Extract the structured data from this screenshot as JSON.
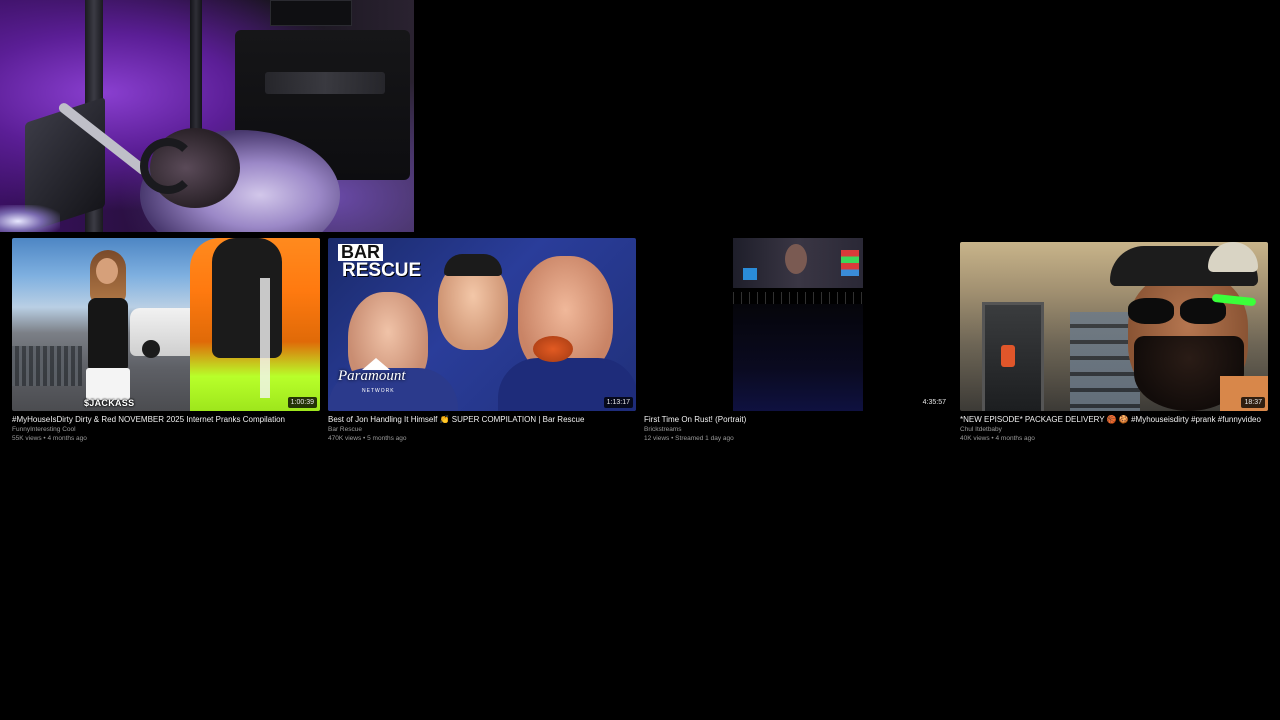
{
  "webcam": {
    "label": "Streamer webcam overlay"
  },
  "videos": [
    {
      "title": "#MyHouseIsDirty Dirty & Red NOVEMBER 2025 Internet Pranks Compilation",
      "channel": "FunnyInteresting Cool",
      "stats": "55K views • 4 months ago",
      "duration": "1:00:39",
      "thumb_text": "$JACKASS"
    },
    {
      "title": "Best of Jon Handling It Himself 👏 SUPER COMPILATION | Bar Rescue",
      "channel": "Bar Rescue",
      "stats": "470K views • 5 months ago",
      "duration": "1:13:17",
      "thumb_text_1": "BAR",
      "thumb_text_2": "RESCUE",
      "thumb_text_3": "Paramount",
      "thumb_text_4": "NETWORK"
    },
    {
      "title": "First Time On Rust! (Portrait)",
      "channel": "Brickstreams",
      "stats": "12 views • Streamed 1 day ago",
      "duration": "4:35:57"
    },
    {
      "title": "*NEW EPISODE* PACKAGE DELIVERY 🏀 🍪 #Myhouseisdirty #prank #funnyvideo",
      "channel": "Chul Itdetbaby",
      "stats": "40K views • 4 months ago",
      "duration": "18:37"
    }
  ]
}
